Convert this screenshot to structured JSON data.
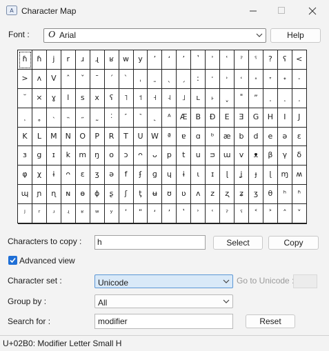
{
  "window": {
    "title": "Character Map"
  },
  "font": {
    "label": "Font :",
    "value": "Arial",
    "type_icon": "italic-O-icon"
  },
  "buttons": {
    "help": "Help",
    "select": "Select",
    "copy": "Copy",
    "reset": "Reset"
  },
  "character_grid": [
    "ɦ",
    "ɦ",
    "j",
    "r",
    "ɹ",
    "ɻ",
    "ʁ",
    "w",
    "y",
    "ʼ",
    "ʻ",
    "ʼ",
    "ʽ",
    "ʾ",
    "ʿ",
    "ˀ",
    "ˁ",
    "?",
    "ʕ",
    "<",
    ">",
    "ʌ",
    "V",
    "ˆ",
    "ˇ",
    "ˉ",
    "ˊ",
    "ˋ",
    "ˌ",
    "ˍ",
    "ˎ",
    "ˏ",
    "ː",
    "ˑ",
    "˒",
    "˓",
    "˔",
    "˕",
    "˖",
    "˗",
    "˘",
    "×",
    "ɣ",
    "l",
    "s",
    "x",
    "ʕ",
    "˥",
    "˦",
    "˧",
    "˨",
    "˩",
    "ʟ",
    "˫",
    "ˬ",
    "˭",
    "ˮ",
    "˯",
    "˰",
    "˱",
    "˲",
    "˳",
    "˴",
    "˵",
    "˶",
    "˷",
    "˸",
    "˹",
    "˺",
    "˻",
    "ᴬ",
    "Æ",
    "B",
    "Ð",
    "E",
    "Ǝ",
    "G",
    "H",
    "I",
    "J",
    "K",
    "L",
    "M",
    "N",
    "O",
    "P",
    "R",
    "T",
    "U",
    "W",
    "ª",
    "ɐ",
    "ɑ",
    "ᵇ",
    "æ",
    "b",
    "d",
    "e",
    "ə",
    "ɛ",
    "ɜ",
    "g",
    "ɪ",
    "k",
    "m",
    "ŋ",
    "o",
    "ɔ",
    "ᴖ",
    "ᴗ",
    "p",
    "t",
    "u",
    "ᴝ",
    "ɯ",
    "v",
    "ᴥ",
    "β",
    "γ",
    "δ",
    "φ",
    "χ",
    "ɨ",
    "ᴖ",
    "ɛ",
    "ʒ",
    "ə",
    "f",
    "ʄ",
    "ɡ",
    "ɥ",
    "ɨ",
    "ɩ",
    "ɪ",
    "ɭ",
    "ʝ",
    "ɟ",
    "ɭ",
    "ɱ",
    "ʍ",
    "ɰ",
    "ɲ",
    "ɳ",
    "ɴ",
    "ɵ",
    "ɸ",
    "ʂ",
    "ʃ",
    "ƫ",
    "ʉ",
    "ʊ",
    "ʋ",
    "ʌ",
    "z",
    "ʐ",
    "ʑ",
    "ʒ",
    "θ",
    "ʰ",
    "ʱ",
    "ʲ",
    "ʳ",
    "ʴ",
    "ʵ",
    "ʶ",
    "ʷ",
    "ʸ",
    "ʹ",
    "ʺ",
    "ʻ",
    "ʼ",
    "ʽ",
    "ʾ",
    "ʿ",
    "ˀ",
    "ˁ",
    "˂",
    "˃",
    "˄",
    "˅",
    "ː",
    "=",
    "",
    "",
    "",
    "",
    "",
    "",
    "",
    "",
    "",
    "",
    "",
    "",
    "",
    "",
    "",
    "",
    "",
    ""
  ],
  "copy": {
    "label": "Characters to copy :",
    "value": "h"
  },
  "advanced_view": {
    "label": "Advanced view",
    "checked": true
  },
  "character_set": {
    "label": "Character set :",
    "value": "Unicode"
  },
  "goto_unicode": {
    "label": "Go to Unicode :"
  },
  "group_by": {
    "label": "Group by :",
    "value": "All"
  },
  "search": {
    "label": "Search for :",
    "value": "modifier"
  },
  "status": {
    "text": "U+02B0: Modifier Letter Small H"
  },
  "colors": {
    "accent": "#1f6fd6",
    "window_bg": "#f3f3f3",
    "active_combo_bg": "#d9e9f8"
  }
}
